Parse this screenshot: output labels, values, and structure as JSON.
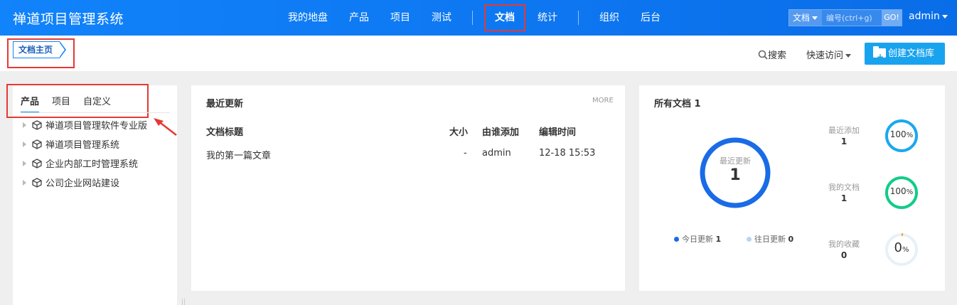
{
  "header": {
    "brand": "禅道项目管理系统",
    "nav": [
      {
        "label": "我的地盘"
      },
      {
        "label": "产品"
      },
      {
        "label": "项目"
      },
      {
        "label": "测试"
      },
      {
        "label": "文档"
      },
      {
        "label": "统计"
      },
      {
        "label": "组织"
      },
      {
        "label": "后台"
      }
    ],
    "search_type": "文档",
    "search_placeholder": "编号(ctrl+g)",
    "go": "GO!",
    "user": "admin"
  },
  "subbar": {
    "breadcrumb": "文档主页",
    "search": "搜索",
    "quick_access": "快速访问",
    "create": "创建文档库"
  },
  "left": {
    "tabs": [
      "产品",
      "项目",
      "自定义"
    ],
    "active_tab": "产品",
    "tree": [
      "禅道项目管理软件专业版",
      "禅道项目管理系统",
      "企业内部工时管理系统",
      "公司企业网站建设"
    ]
  },
  "recent": {
    "title": "最近更新",
    "more": "MORE",
    "columns": {
      "title": "文档标题",
      "size": "大小",
      "added_by": "由谁添加",
      "edited": "编辑时间"
    },
    "rows": [
      {
        "title": "我的第一篇文章",
        "size": "-",
        "added_by": "admin",
        "edited": "12-18 15:53"
      }
    ]
  },
  "all_docs": {
    "title": "所有文档 1",
    "ring_label": "最近更新",
    "ring_value": "1",
    "legend_today_label": "今日更新",
    "legend_today_value": "1",
    "legend_past_label": "往日更新",
    "legend_past_value": "0",
    "stats": [
      {
        "label": "最近添加",
        "value": "1",
        "percent_num": "100",
        "percent_unit": "%",
        "fraction": 1.0,
        "color": "#1ba8ef"
      },
      {
        "label": "我的文档",
        "value": "1",
        "percent_num": "100",
        "percent_unit": "%",
        "fraction": 1.0,
        "color": "#11cc88"
      },
      {
        "label": "我的收藏",
        "value": "0",
        "percent_num": "0",
        "percent_unit": "%",
        "fraction": 0.0,
        "color": "#f5a623"
      }
    ]
  },
  "colors": {
    "header": "#1183fb",
    "accent": "#19a3ef",
    "ring_main": "#1a6be6",
    "highlight": "#e53935"
  }
}
